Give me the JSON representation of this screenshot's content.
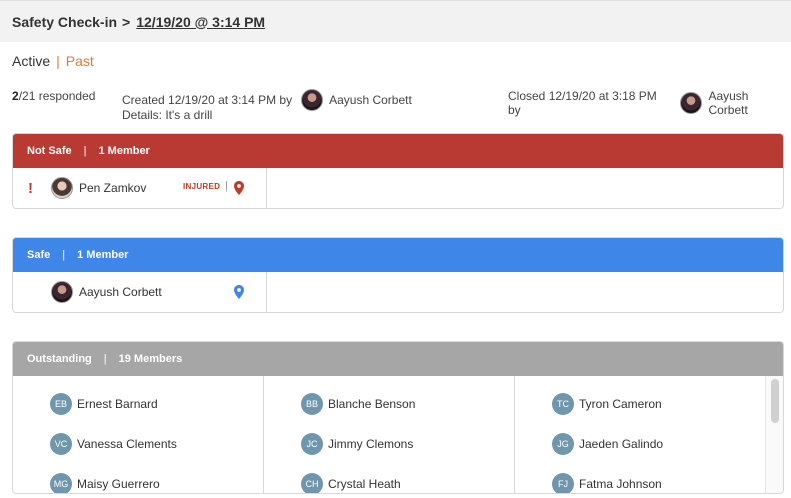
{
  "header": {
    "title": "Safety Check-in",
    "separator": ">",
    "breadcrumb": "12/19/20 @ 3:14 PM"
  },
  "tabs": {
    "active": "Active",
    "divider": "|",
    "past": "Past"
  },
  "summary": {
    "responded_count": "2",
    "responded_text": "/21 responded",
    "created_text": "Created 12/19/20 at 3:14 PM by",
    "created_by": "Aayush Corbett",
    "details": "Details: It's a drill",
    "closed_text": "Closed 12/19/20 at 3:18 PM by",
    "closed_by": "Aayush Corbett"
  },
  "not_safe": {
    "label": "Not Safe",
    "bar": "|",
    "count": "1 Member",
    "members": [
      {
        "name": "Pen Zamkov",
        "alert": "!",
        "status": "INJURED",
        "status_divider": "|"
      }
    ]
  },
  "safe": {
    "label": "Safe",
    "bar": "|",
    "count": "1 Member",
    "members": [
      {
        "name": "Aayush Corbett"
      }
    ]
  },
  "outstanding": {
    "label": "Outstanding",
    "bar": "|",
    "count": "19 Members",
    "columns": [
      [
        {
          "initials": "EB",
          "name": "Ernest Barnard"
        },
        {
          "initials": "VC",
          "name": "Vanessa Clements"
        },
        {
          "initials": "MG",
          "name": "Maisy Guerrero"
        }
      ],
      [
        {
          "initials": "BB",
          "name": "Blanche Benson"
        },
        {
          "initials": "JC",
          "name": "Jimmy Clemons"
        },
        {
          "initials": "CH",
          "name": "Crystal Heath"
        }
      ],
      [
        {
          "initials": "TC",
          "name": "Tyron Cameron"
        },
        {
          "initials": "JG",
          "name": "Jaeden Galindo"
        },
        {
          "initials": "FJ",
          "name": "Fatma Johnson"
        }
      ]
    ]
  },
  "icons": {
    "alert": "exclamation-icon",
    "location": "map-pin-icon"
  },
  "colors": {
    "not_safe": "#b93a33",
    "safe": "#3f86e9",
    "outstanding": "#a6a6a6",
    "accent": "#e07b2a",
    "initials_bg": "#6f96ac"
  }
}
